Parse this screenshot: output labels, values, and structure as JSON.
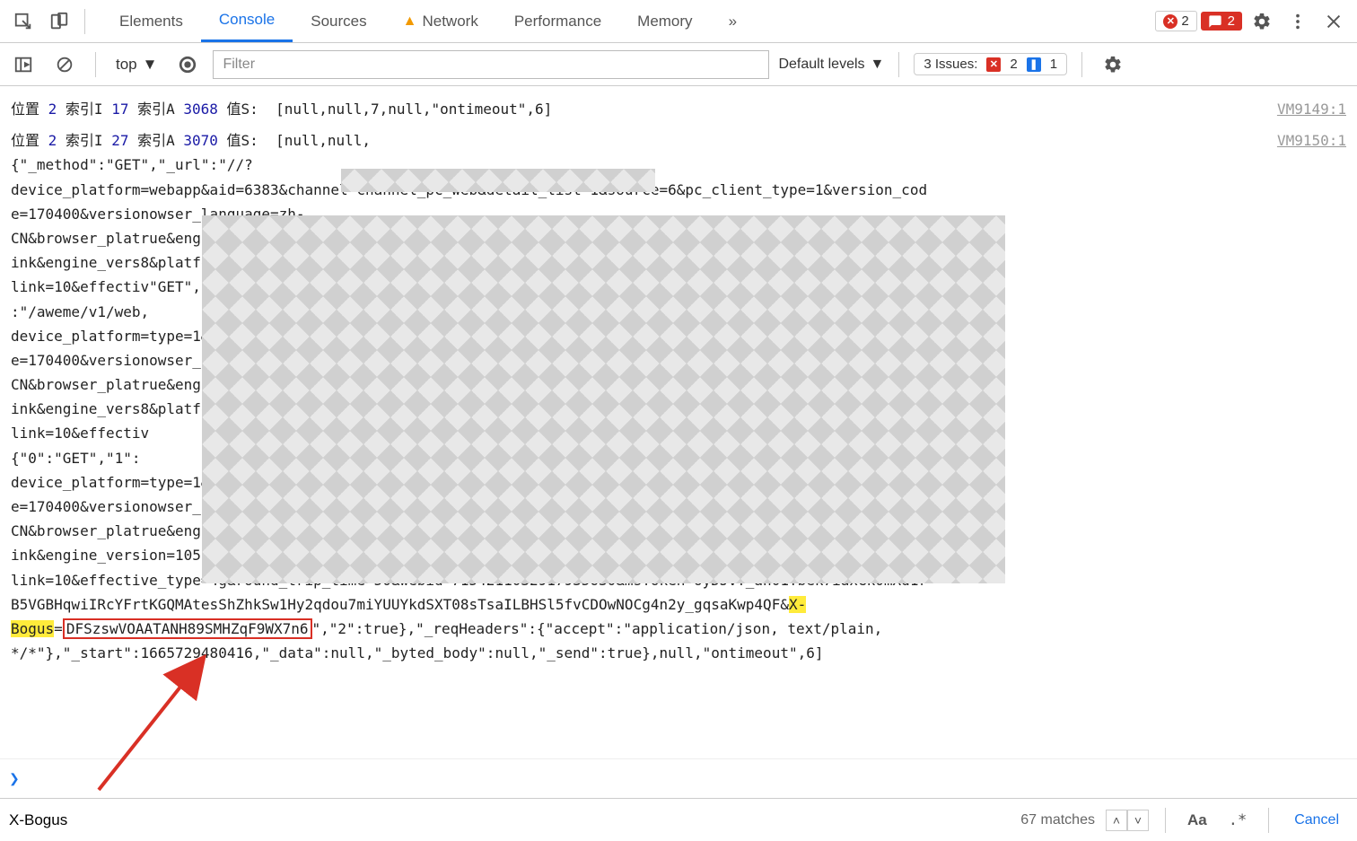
{
  "toolbar": {
    "tabs": {
      "elements": "Elements",
      "console": "Console",
      "sources": "Sources",
      "network": "Network",
      "performance": "Performance",
      "memory": "Memory"
    },
    "error_badge_count": "2",
    "ext_error_count": "2"
  },
  "filterbar": {
    "context": "top",
    "filter_placeholder": "Filter",
    "levels": "Default levels",
    "issues_label": "3 Issues:",
    "issues_red": "2",
    "issues_blue": "1"
  },
  "log1": {
    "prefix": "位置 ",
    "pos_num": "2",
    "idx_i_label": " 索引I ",
    "idx_i": "17",
    "idx_a_label": " 索引A ",
    "idx_a": "3068",
    "val_label": " 值S:  ",
    "val": "[null,null,7,null,\"ontimeout\",6]",
    "source": "VM9149:1"
  },
  "log2": {
    "prefix": "位置 ",
    "pos_num": "2",
    "idx_i_label": " 索引I ",
    "idx_i": "27",
    "idx_a_label": " 索引A ",
    "idx_a": "3070",
    "val_label": " 值S:  ",
    "source": "VM9150:1",
    "body_part0": "[null,null,\n{\"_method\":\"GET\",\"_url\":\"/",
    "body_part0a": "/?\ndevice_platform=webapp&aid=6383&channel=channel_pc_web&detail_list=1&source=6&pc_client_type=1&version_cod\ne=170400&version",
    "body_part1": "owser_language=zh-\nCN&browser_plat",
    "body_part2": "rue&engine_name=Bl\nink&engine_vers",
    "body_part3": "8&platform=PC&down\nlink=10&effectiv",
    "body_part4": "\"GET\",\"_byted_url\"\n:\"/aweme/v1/web,\ndevice_platform=",
    "body_part5": "type=1&version_cod\ne=170400&version",
    "body_part6": "owser_language=zh-\nCN&browser_plat",
    "body_part7": "rue&engine_name=Bl\nink&engine_vers",
    "body_part8": "8&platform=PC&down\nlink=10&effectiv\n{\"0\":\"GET\",\"1\":\ndevice_platform=",
    "body_part9": "type=1&version_cod\ne=170400&version",
    "body_part10": "owser_language=zh-\nCN&browser_plat",
    "body_part11": "rue&engine_name=Bl\nink&engine_version=105.0.0.0&os_name=Windows&os_version=10&cpu_core_num=8&device_memory=8&platform=PC&down\nlink=10&effective_type=4g&round_trip_time=50&webid=7154211032917935630&msToken=oyDJvY_an01Ybek7iaxGk0mXd1r\nB5VGBHqwiIRcYFrtKGQMAtesShZhkSw1Hy2qdou7miYUUYkdSXT08sTsaILBHSl5fvCDOwNOCg4n2y_gqsaKwp4QF&",
    "xbogus_key": "X-\nBogus",
    "xbogus_eq": "=",
    "xbogus_val": "DFSzswVOAATANH89SMHZqF9WX7n6",
    "body_tail": "\",\"2\":true},\"_reqHeaders\":{\"accept\":\"application/json, text/plain, \n*/*\"},\"_start\":1665729480416,\"_data\":null,\"_byted_body\":null,\"_send\":true},null,\"ontimeout\",6]"
  },
  "search": {
    "value": "X-Bogus",
    "matches": "67 matches",
    "cancel": "Cancel",
    "aa": "Aa",
    "regex": ".*"
  }
}
